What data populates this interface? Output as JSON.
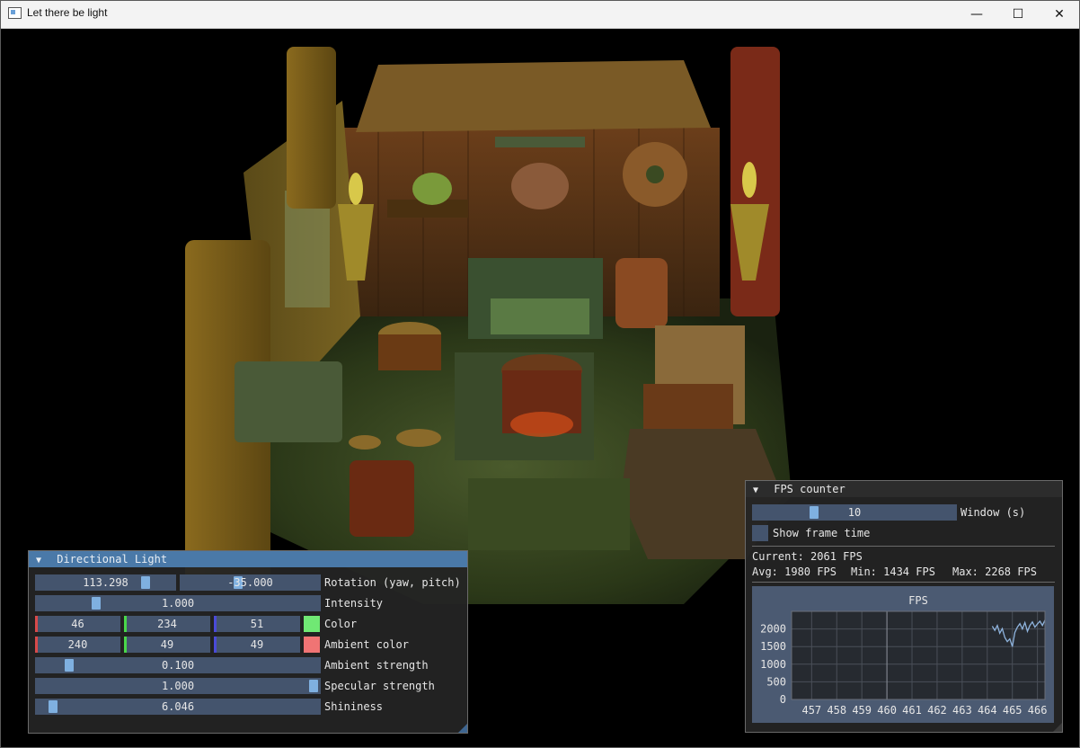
{
  "window": {
    "title": "Let there be light",
    "minimize_glyph": "—",
    "maximize_glyph": "☐",
    "close_glyph": "✕"
  },
  "directional_light": {
    "title": "Directional Light",
    "collapse_glyph": "▼",
    "rotation": {
      "yaw": "113.298",
      "pitch": "-35.000",
      "label": "Rotation (yaw, pitch)"
    },
    "intensity": {
      "value": "1.000",
      "label": "Intensity"
    },
    "color": {
      "r": "46",
      "g": "234",
      "b": "51",
      "label": "Color",
      "swatch": "#2eea33"
    },
    "ambient_color": {
      "r": "240",
      "g": "49",
      "b": "49",
      "label": "Ambient color",
      "swatch": "#f03131"
    },
    "ambient_strength": {
      "value": "0.100",
      "label": "Ambient strength"
    },
    "specular_strength": {
      "value": "1.000",
      "label": "Specular strength"
    },
    "shininess": {
      "value": "6.046",
      "label": "Shininess"
    }
  },
  "fps_counter": {
    "title": "FPS counter",
    "collapse_glyph": "▼",
    "window": {
      "value": "10",
      "label": "Window (s)"
    },
    "show_frame_time": {
      "label": "Show frame time",
      "checked": false
    },
    "current": "Current: 2061 FPS",
    "avg": "Avg: 1980 FPS",
    "min": "Min: 1434 FPS",
    "max": "Max: 2268 FPS",
    "plot_title": "FPS"
  },
  "chart_data": {
    "type": "line",
    "title": "FPS",
    "xlabel": "",
    "ylabel": "",
    "xlim": [
      456.2,
      466.3
    ],
    "ylim": [
      0,
      2500
    ],
    "x_ticks": [
      "457",
      "458",
      "459",
      "460",
      "461",
      "462",
      "463",
      "464",
      "465",
      "466"
    ],
    "y_ticks": [
      "2000",
      "1500",
      "1000",
      "500",
      "0"
    ],
    "grid": true,
    "series": [
      {
        "color": "#8fb4de",
        "x": [
          464.2,
          464.3,
          464.4,
          464.5,
          464.6,
          464.7,
          464.8,
          464.9,
          465.0,
          465.1,
          465.2,
          465.3,
          465.4,
          465.5,
          465.6,
          465.7,
          465.8,
          465.9,
          466.0,
          466.1,
          466.2,
          466.3
        ],
        "y": [
          2080,
          1960,
          2100,
          1880,
          2010,
          1760,
          1640,
          1720,
          1500,
          1900,
          2050,
          2150,
          2000,
          2180,
          1930,
          2100,
          2200,
          2050,
          2140,
          2220,
          2100,
          2250
        ]
      }
    ],
    "vline_x": 460
  }
}
